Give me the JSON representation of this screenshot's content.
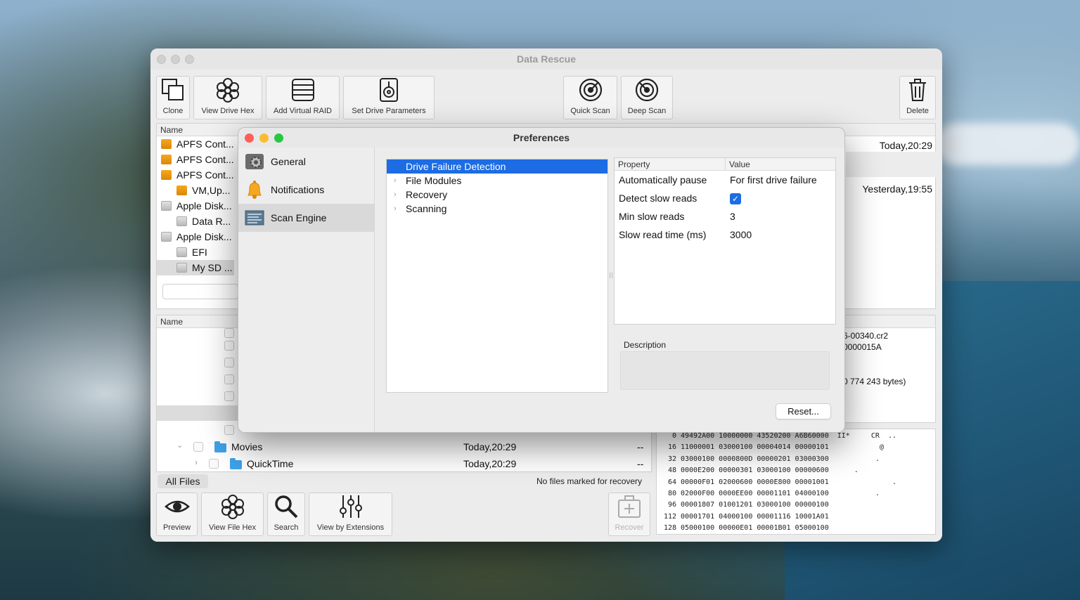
{
  "window": {
    "title": "Data Rescue"
  },
  "toolbar": {
    "clone": "Clone",
    "view_drive_hex": "View Drive Hex",
    "add_virtual_raid": "Add Virtual RAID",
    "set_drive_parameters": "Set Drive Parameters",
    "quick_scan": "Quick Scan",
    "deep_scan": "Deep Scan",
    "delete": "Delete"
  },
  "drives": {
    "header": "Name",
    "items": [
      {
        "label": "APFS Cont...",
        "kind": "orange-disk"
      },
      {
        "label": "APFS Cont...",
        "kind": "orange-disk"
      },
      {
        "label": "APFS Cont...",
        "kind": "orange-disk"
      },
      {
        "label": "VM,Up...",
        "kind": "orange-disk"
      },
      {
        "label": "Apple Disk...",
        "kind": "gray-disk"
      },
      {
        "label": "Data R...",
        "kind": "gray-disk"
      },
      {
        "label": "Apple Disk...",
        "kind": "gray-disk"
      },
      {
        "label": "EFI",
        "kind": "gray-disk"
      },
      {
        "label": "My SD ...",
        "kind": "gray-disk"
      }
    ],
    "dates": [
      "Today,20:29",
      "Yesterday,19:55"
    ]
  },
  "files": {
    "header": "Name",
    "rows": [
      {
        "name": "Movies",
        "date": "Today,20:29",
        "size": "--"
      },
      {
        "name": "QuickTime",
        "date": "Today,20:29",
        "size": "--"
      }
    ],
    "filter_label": "All Files",
    "status": "No files marked for recovery"
  },
  "file_info": {
    "name_fragment": "6-00340.cr2",
    "id_fragment": "0000015A",
    "size_fragment": "0 774 243 bytes)"
  },
  "bottom_toolbar": {
    "preview": "Preview",
    "view_file_hex": "View File Hex",
    "search": "Search",
    "view_by_extensions": "View by Extensions",
    "recover": "Recover"
  },
  "hex": {
    "rows": [
      {
        "offset": "0",
        "bytes": "49492A00 10000000 43520200 A6B60000",
        "ascii": "II*     CR  .."
      },
      {
        "offset": "16",
        "bytes": "11000001 03000100 00004014 00000101",
        "ascii": "          @"
      },
      {
        "offset": "32",
        "bytes": "03000100 0000800D 00000201 03000300",
        "ascii": "         ."
      },
      {
        "offset": "48",
        "bytes": "0000E200 00000301 03000100 00000600",
        "ascii": "    ."
      },
      {
        "offset": "64",
        "bytes": "00000F01 02000600 0000E800 00001001",
        "ascii": "             ."
      },
      {
        "offset": "80",
        "bytes": "02000F00 0000EE00 00001101 04000100",
        "ascii": "         ."
      },
      {
        "offset": "96",
        "bytes": "00001807 01001201 03000100 00000100",
        "ascii": ""
      },
      {
        "offset": "112",
        "bytes": "00001701 04000100 00001116 10001A01",
        "ascii": ""
      },
      {
        "offset": "128",
        "bytes": "05000100 00000E01 00001B01 05000100",
        "ascii": ""
      }
    ]
  },
  "preferences": {
    "title": "Preferences",
    "sidebar": [
      {
        "label": "General"
      },
      {
        "label": "Notifications"
      },
      {
        "label": "Scan Engine"
      }
    ],
    "categories": [
      {
        "label": "Drive Failure Detection"
      },
      {
        "label": "File Modules"
      },
      {
        "label": "Recovery"
      },
      {
        "label": "Scanning"
      }
    ],
    "table": {
      "col_property": "Property",
      "col_value": "Value",
      "rows": [
        {
          "property": "Automatically pause",
          "value": "For first drive failure"
        },
        {
          "property": "Detect slow reads",
          "value": ""
        },
        {
          "property": "Min slow reads",
          "value": "3"
        },
        {
          "property": "Slow read time (ms)",
          "value": "3000"
        }
      ]
    },
    "description_label": "Description",
    "reset_label": "Reset..."
  },
  "colors": {
    "accent": "#1d6ce3",
    "close": "#fe5f57",
    "minimize": "#febc2e",
    "zoom": "#28c840"
  }
}
